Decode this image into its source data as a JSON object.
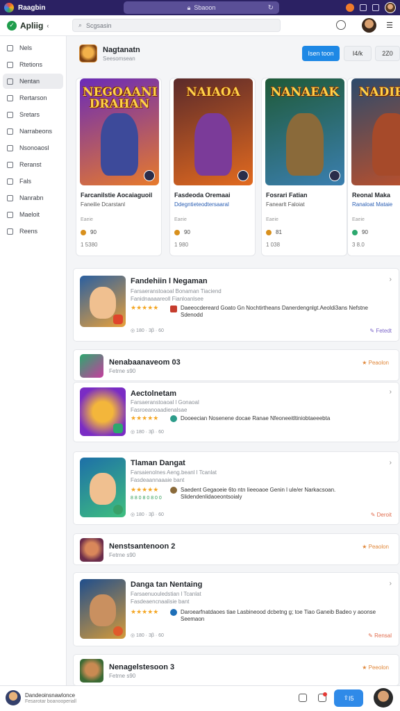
{
  "browser": {
    "tab_title": "Raagbin",
    "url": "Sbaoon"
  },
  "app": {
    "brand": "Apliig",
    "search_placeholder": "Scgsasin"
  },
  "sidebar": {
    "items": [
      {
        "label": "Nels"
      },
      {
        "label": "Rtetions"
      },
      {
        "label": "Nentan"
      },
      {
        "label": "Rertarson"
      },
      {
        "label": "Sretars"
      },
      {
        "label": "Narrabeons"
      },
      {
        "label": "Nsonoaosl"
      },
      {
        "label": "Reranst"
      },
      {
        "label": "Fals"
      },
      {
        "label": "Nanrabn"
      },
      {
        "label": "Maeloit"
      },
      {
        "label": "Reens"
      }
    ]
  },
  "page_header": {
    "title": "Nagtanatn",
    "subtitle": "Seesomsean",
    "primary_button": "Isen toon",
    "secondary_button_1": "I4/k",
    "secondary_button_2": "2Z0"
  },
  "featured": [
    {
      "art_text": "NEGOAANI\nDRAHAN",
      "name": "Farcanilstie Aocaiaguoil",
      "developer": "Faneilie Dcarstanl",
      "meta": "Eaeie",
      "coin_value": "90",
      "downloads": "1 5380",
      "colors": {
        "bg1": "#6a2bb8",
        "bg2": "#e77a2b",
        "hero": "#3d4a9a"
      }
    },
    {
      "art_text": "NAIAOA",
      "name": "Fasdeoda Oremaai",
      "developer": "Ddegntieteodtersaaral",
      "meta": "Eaeie",
      "coin_value": "90",
      "downloads": "1 980",
      "colors": {
        "bg1": "#5b2a2a",
        "bg2": "#e26a1f",
        "hero": "#7b3b99"
      }
    },
    {
      "art_text": "NANAEAK",
      "name": "Fosrari Fatian",
      "developer": "Fanearlt Faloiat",
      "meta": "Eaeie",
      "coin_value": "81",
      "downloads": "1 038",
      "colors": {
        "bg1": "#1f5a38",
        "bg2": "#3b7fb0",
        "hero": "#8a6a3a"
      }
    },
    {
      "art_text": "NADIEAK",
      "name": "Reonal Maka",
      "developer": "Ranaloat Mataie",
      "meta": "Eaeie",
      "coin_value": "90",
      "downloads": "3 8.0",
      "colors": {
        "bg1": "#2c4a6b",
        "bg2": "#c0502a",
        "hero": "#a64a2a"
      }
    }
  ],
  "cards": [
    {
      "name": "Fandehiin l Negaman",
      "line1": "Farsaeranstoaoal Bonaman Tiaciend",
      "line2": "Fanidnaaaareoll Fianloanlsee",
      "stars": "★★★★★",
      "desc": "Daeeocdereard Goato Gn Nochtirtheans Danerdengnlgt.Aeoldi3ans Nefstne Sdenodd",
      "stats": "◎ 180 · 3β · 60",
      "action": "Fetedt",
      "colors": {
        "bg1": "#2a5fa0",
        "bg2": "#e9a13a",
        "fx": "#e0452c"
      }
    },
    {
      "name": "Aectolnetam",
      "line1": "Farsaeranstoaoal l Gonaoal",
      "line2": "Fasroeanoaadienalsae",
      "stars": "★★★★★",
      "desc": "Dooeecian Nosenene docae Ranae Nfeoneeitltiniobtaeeebta",
      "stats": "◎ 180 · 3β · 60",
      "colors": {
        "bg1": "#7a2cc4",
        "bg2": "#f3b63b",
        "fx": "#2ca86e"
      }
    },
    {
      "name": "Tlaman Dangat",
      "line1": "Farsaienolnes Aeng.beanl l Tcanlat",
      "line2": "Fasdeaannaaaie bant",
      "stars": "★★★★★",
      "extra": "8 8 0 8 0 8 0 0",
      "desc": "Saedent Gegaoeie 6to ntn Iieeoaoe Genin l ule/er Narkacsoan. Slidendenlidaoeontsoialy",
      "stats": "◎ 180 · 3β · 60",
      "action": "Deroit",
      "colors": {
        "bg1": "#1d6fa8",
        "bg2": "#3fbf7f",
        "fx": "#38a169"
      }
    },
    {
      "name": "Danga tan Nentaing",
      "line1": "Farsaenuouledstian l Tcanlat",
      "line2": "Fasdeaencnaalisie bant",
      "stars": "★★★★★",
      "desc": "Daroearfnatdaoes tiae Lasbineood dcbetng g; toe Tiao Ganeib Badeo y aoonse Seemaon",
      "stats": "◎ 180 · 3β · 60",
      "action": "Rensal",
      "colors": {
        "bg1": "#1f4e8c",
        "bg2": "#d49a3a",
        "fx": "#e05a2c"
      }
    }
  ],
  "sections": [
    {
      "title": "Nenabaanaveom 03",
      "subtitle": "Fetrne s90",
      "action": "Peaolon"
    },
    {
      "title": "Nenstsantenoon 2",
      "subtitle": "Fetrne s90",
      "action": "Peaolon"
    },
    {
      "title": "Nenagelstesoon 3",
      "subtitle": "Fetrne s90",
      "action": "Peeolon"
    }
  ],
  "bottom_bar": {
    "title": "Dandeoinsnawlonce",
    "subtitle": "Fesarotar boanooperiall",
    "primary": "I5"
  }
}
